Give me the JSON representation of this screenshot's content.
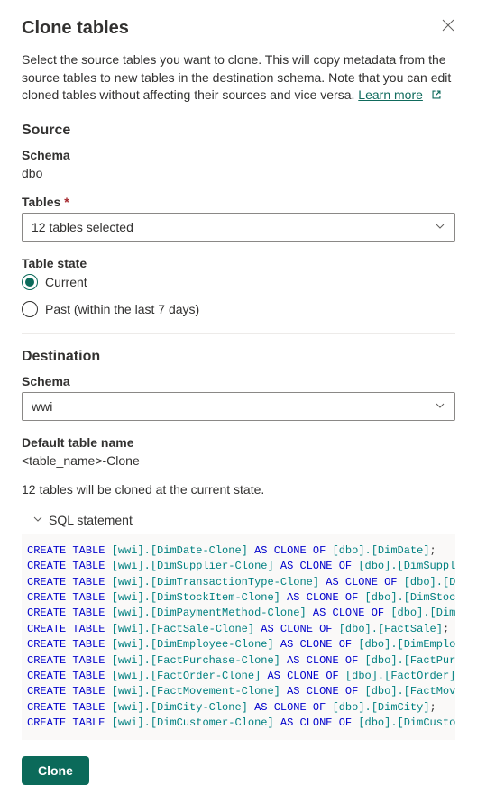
{
  "header": {
    "title": "Clone tables"
  },
  "description_text": "Select the source tables you want to clone. This will copy metadata from the source tables to new tables in the destination schema. Note that you can edit cloned tables without affecting their sources and vice versa. ",
  "learn_more_label": "Learn more",
  "source": {
    "heading": "Source",
    "schema_label": "Schema",
    "schema_value": "dbo",
    "tables_label": "Tables",
    "tables_selected": "12 tables selected",
    "table_state_label": "Table state",
    "state_options": {
      "current": "Current",
      "past": "Past (within the last 7 days)"
    }
  },
  "destination": {
    "heading": "Destination",
    "schema_label": "Schema",
    "schema_value": "wwi",
    "default_name_label": "Default table name",
    "default_name_value": "<table_name>-Clone"
  },
  "status_line": "12 tables will be cloned at the current state.",
  "sql_section_label": "SQL statement",
  "sql_lines": [
    {
      "dst": "[wwi].[DimDate-Clone]",
      "src": "[dbo].[DimDate]"
    },
    {
      "dst": "[wwi].[DimSupplier-Clone]",
      "src": "[dbo].[DimSupplier]"
    },
    {
      "dst": "[wwi].[DimTransactionType-Clone]",
      "src": "[dbo].[DimTra"
    },
    {
      "dst": "[wwi].[DimStockItem-Clone]",
      "src": "[dbo].[DimStockItem"
    },
    {
      "dst": "[wwi].[DimPaymentMethod-Clone]",
      "src": "[dbo].[DimPayme"
    },
    {
      "dst": "[wwi].[FactSale-Clone]",
      "src": "[dbo].[FactSale]"
    },
    {
      "dst": "[wwi].[DimEmployee-Clone]",
      "src": "[dbo].[DimEmployee]"
    },
    {
      "dst": "[wwi].[FactPurchase-Clone]",
      "src": "[dbo].[FactPurchase"
    },
    {
      "dst": "[wwi].[FactOrder-Clone]",
      "src": "[dbo].[FactOrder]"
    },
    {
      "dst": "[wwi].[FactMovement-Clone]",
      "src": "[dbo].[FactMovement"
    },
    {
      "dst": "[wwi].[DimCity-Clone]",
      "src": "[dbo].[DimCity]"
    },
    {
      "dst": "[wwi].[DimCustomer-Clone]",
      "src": "[dbo].[DimCustomer]"
    }
  ],
  "clone_button_label": "Clone"
}
